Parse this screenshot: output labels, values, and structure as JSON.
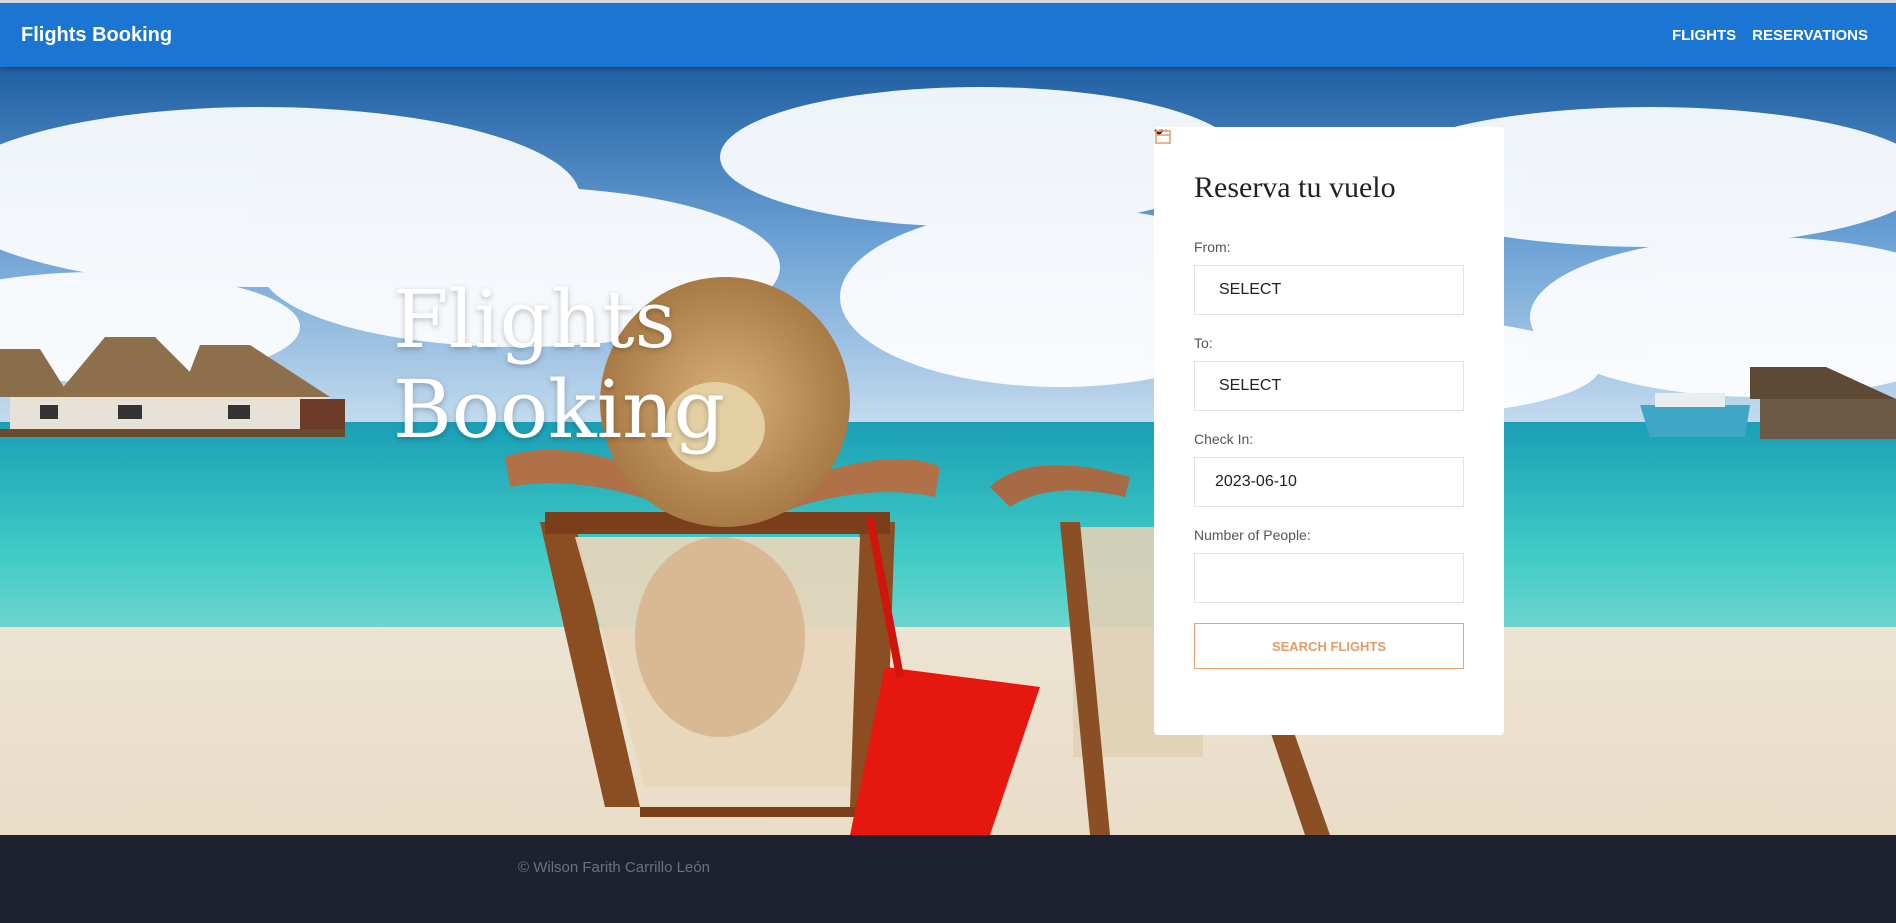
{
  "navbar": {
    "brand": "Flights Booking",
    "links": [
      {
        "label": "FLIGHTS"
      },
      {
        "label": "RESERVATIONS"
      }
    ],
    "color": "#1b76d3"
  },
  "hero": {
    "title_line1": "Flights",
    "title_line2": "Booking"
  },
  "form": {
    "title": "Reserva tu vuelo",
    "from_label": "From:",
    "from_value": "SELECT",
    "to_label": "To:",
    "to_value": "SELECT",
    "checkin_label": "Check In:",
    "checkin_value": "2023-06-10",
    "people_label": "Number of People:",
    "people_value": "",
    "submit_label": "SEARCH FLIGHTS",
    "accent_color": "#e29c66"
  },
  "footer": {
    "copyright": "© Wilson Farith Carrillo León"
  }
}
